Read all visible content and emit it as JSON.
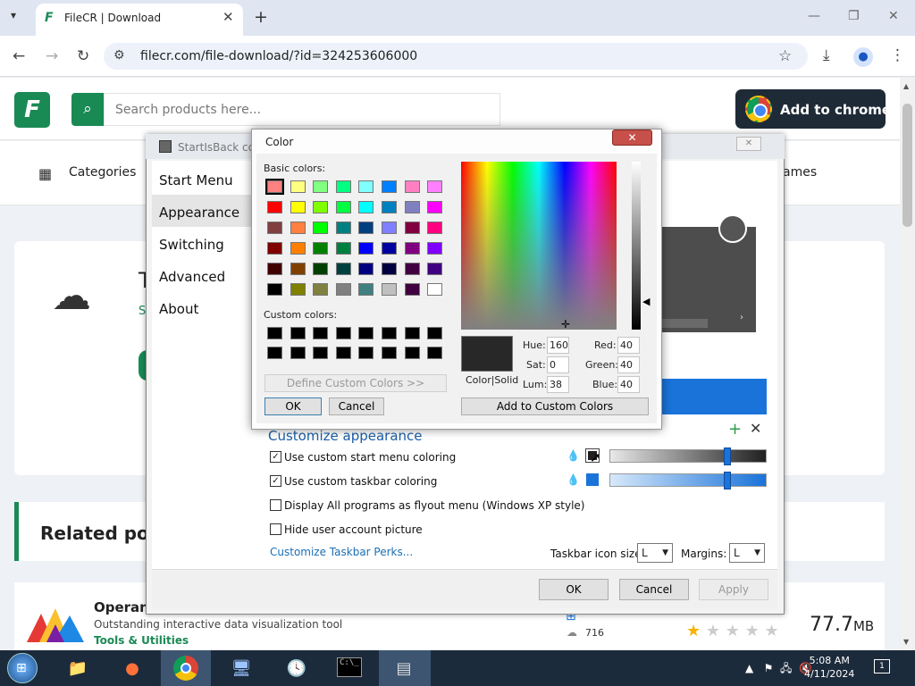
{
  "browser": {
    "tab_title": "FileCR | Download",
    "url": "filecr.com/file-download/?id=324253606000"
  },
  "site": {
    "search_placeholder": "Search products here...",
    "add_to_chrome": "Add to chrome",
    "categories": "Categories",
    "games_partial": "ames",
    "card1_partial_letter": "T",
    "card1_partial_s": "S",
    "related_posts": "Related posts",
    "product": {
      "name": "Operant",
      "desc": "Outstanding interactive data visualization tool",
      "category": "Tools & Utilities",
      "downloads": "716",
      "size_value": "77.7",
      "size_unit": "MB",
      "rating": 1
    }
  },
  "startisback": {
    "title": "StartIsBack configuration",
    "nav": [
      "Start Menu",
      "Appearance",
      "Switching",
      "Advanced",
      "About"
    ],
    "selected_nav": "Appearance",
    "customize_title": "Customize appearance",
    "options": [
      {
        "label": "Use custom start menu coloring",
        "checked": true
      },
      {
        "label": "Use custom taskbar coloring",
        "checked": true
      },
      {
        "label": "Display All programs as flyout menu (Windows XP style)",
        "checked": false
      },
      {
        "label": "Hide user account picture",
        "checked": false
      }
    ],
    "start_menu_color": "#202020",
    "taskbar_color": "#1a73d9",
    "perks_link": "Customize Taskbar Perks...",
    "taskbar_icon_size_label": "Taskbar icon size:",
    "taskbar_icon_size_value": "L",
    "margins_label": "Margins:",
    "margins_value": "L",
    "ok": "OK",
    "cancel": "Cancel",
    "apply": "Apply"
  },
  "color_dialog": {
    "title": "Color",
    "basic_colors_label": "Basic colors:",
    "custom_colors_label": "Custom colors:",
    "basic_colors": [
      "#ff8080",
      "#ffff80",
      "#80ff80",
      "#00ff80",
      "#80ffff",
      "#0080ff",
      "#ff80c0",
      "#ff80ff",
      "#ff0000",
      "#ffff00",
      "#80ff00",
      "#00ff40",
      "#00ffff",
      "#0080c0",
      "#8080c0",
      "#ff00ff",
      "#804040",
      "#ff8040",
      "#00ff00",
      "#008080",
      "#004080",
      "#8080ff",
      "#800040",
      "#ff0080",
      "#800000",
      "#ff8000",
      "#008000",
      "#008040",
      "#0000ff",
      "#0000a0",
      "#800080",
      "#8000ff",
      "#400000",
      "#804000",
      "#004000",
      "#004040",
      "#000080",
      "#000040",
      "#400040",
      "#400080",
      "#000000",
      "#808000",
      "#808040",
      "#808080",
      "#408080",
      "#c0c0c0",
      "#400040",
      "#ffffff"
    ],
    "custom_colors": [
      "#000000",
      "#000000",
      "#000000",
      "#000000",
      "#000000",
      "#000000",
      "#000000",
      "#000000",
      "#000000",
      "#000000",
      "#000000",
      "#000000",
      "#000000",
      "#000000",
      "#000000",
      "#000000"
    ],
    "color_solid_label": "Color|Solid",
    "hue_label": "Hue:",
    "hue": "160",
    "sat_label": "Sat:",
    "sat": "0",
    "lum_label": "Lum:",
    "lum": "38",
    "red_label": "Red:",
    "red": "40",
    "green_label": "Green:",
    "green": "40",
    "blue_label": "Blue:",
    "blue": "40",
    "define_custom": "Define Custom Colors >>",
    "ok": "OK",
    "cancel": "Cancel",
    "add_custom": "Add to Custom Colors"
  },
  "taskbar": {
    "time": "5:08 AM",
    "date": "4/11/2024",
    "notification_count": "1"
  }
}
